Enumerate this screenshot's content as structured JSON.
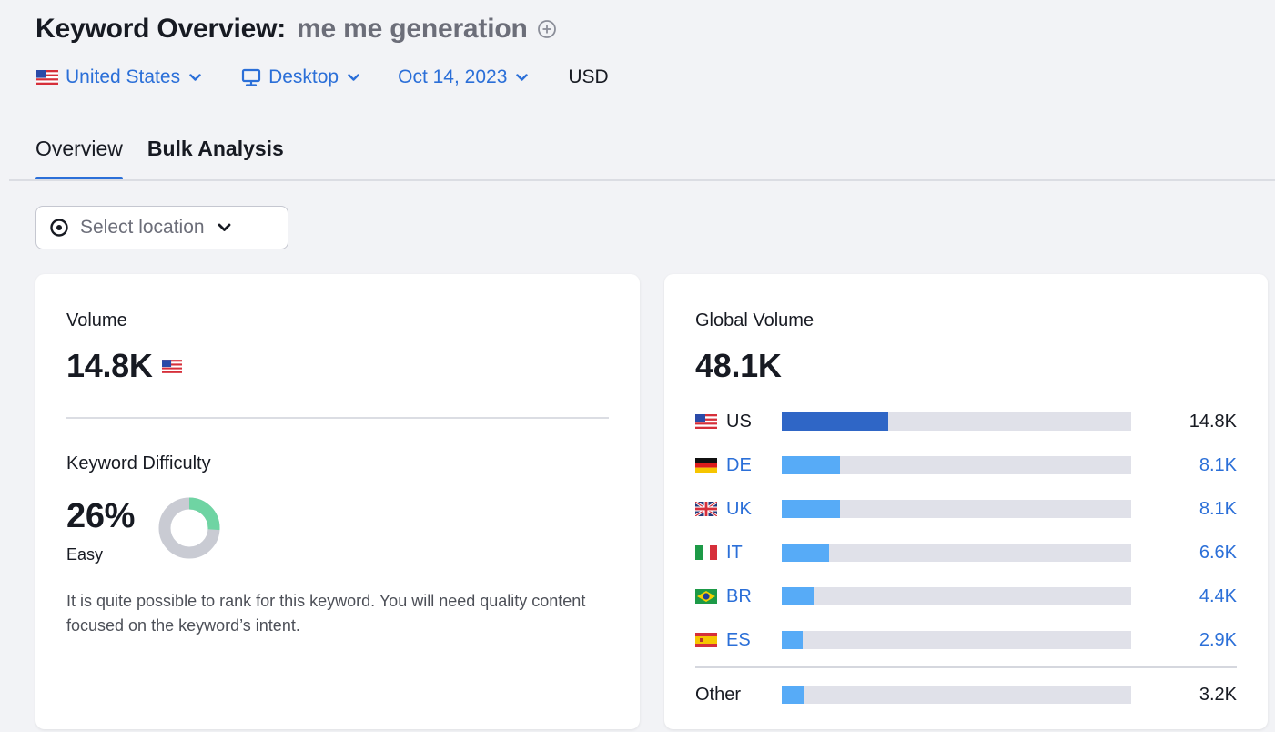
{
  "header": {
    "title_prefix": "Keyword Overview:",
    "keyword": "me me generation",
    "filters": {
      "country": "United States",
      "device": "Desktop",
      "date": "Oct 14, 2023",
      "currency": "USD"
    },
    "tabs": [
      {
        "label": "Overview",
        "active": true
      },
      {
        "label": "Bulk Analysis",
        "active": false
      }
    ]
  },
  "location": {
    "placeholder": "Select location"
  },
  "volume_card": {
    "label": "Volume",
    "value": "14.8K",
    "difficulty_label": "Keyword Difficulty",
    "difficulty_value": "26%",
    "difficulty_percent": 26,
    "difficulty_level": "Easy",
    "difficulty_description": "It is quite possible to rank for this keyword. You will need quality content focused on the keyword’s intent."
  },
  "global_card": {
    "label": "Global Volume",
    "value": "48.1K",
    "countries": [
      {
        "code": "US",
        "flag": "us-flag",
        "value": "14.8K",
        "share": 0.305,
        "primary": true
      },
      {
        "code": "DE",
        "flag": "de-flag",
        "value": "8.1K",
        "share": 0.167,
        "primary": false
      },
      {
        "code": "UK",
        "flag": "uk-flag",
        "value": "8.1K",
        "share": 0.167,
        "primary": false
      },
      {
        "code": "IT",
        "flag": "it-flag",
        "value": "6.6K",
        "share": 0.136,
        "primary": false
      },
      {
        "code": "BR",
        "flag": "br-flag",
        "value": "4.4K",
        "share": 0.09,
        "primary": false
      },
      {
        "code": "ES",
        "flag": "es-flag",
        "value": "2.9K",
        "share": 0.06,
        "primary": false
      }
    ],
    "other": {
      "label": "Other",
      "value": "3.2K",
      "share": 0.066
    }
  },
  "colors": {
    "accent": "#2b6fd8",
    "bar_primary": "#2f66c6",
    "bar_secondary": "#57abf7",
    "donut_fill": "#6fd4a3",
    "donut_track": "#c9cbd3"
  }
}
